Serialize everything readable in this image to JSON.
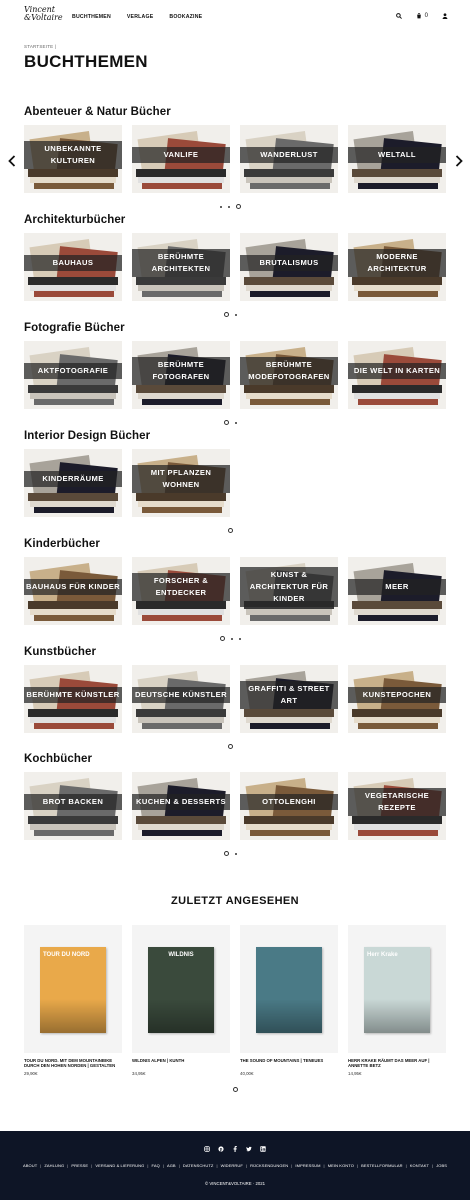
{
  "header": {
    "logo_line1": "Vincent",
    "logo_line2": "&Voltaire",
    "nav": [
      "BUCHTHEMEN",
      "VERLAGE",
      "BOOKAZINE"
    ],
    "cart_count": "0"
  },
  "breadcrumb": "STARTSEITE |",
  "page_title": "BUCHTHEMEN",
  "sections": [
    {
      "title": "Abenteuer & Natur Bücher",
      "tiles": [
        {
          "label": "UNBEKANNTE KULTUREN",
          "lines": 2
        },
        {
          "label": "VANLIFE",
          "lines": 1
        },
        {
          "label": "WANDERLUST",
          "lines": 1
        },
        {
          "label": "WELTALL",
          "lines": 1
        }
      ],
      "dots": 3,
      "active": 2
    },
    {
      "title": "Architekturbücher",
      "tiles": [
        {
          "label": "BAUHAUS",
          "lines": 1
        },
        {
          "label": "BERÜHMTE ARCHITEKTEN",
          "lines": 2
        },
        {
          "label": "BRUTALISMUS",
          "lines": 1
        },
        {
          "label": "MODERNE ARCHITEKTUR",
          "lines": 2
        }
      ],
      "dots": 2,
      "active": 0
    },
    {
      "title": "Fotografie Bücher",
      "tiles": [
        {
          "label": "AKTFOTOGRAFIE",
          "lines": 1
        },
        {
          "label": "BERÜHMTE FOTOGRAFEN",
          "lines": 2
        },
        {
          "label": "BERÜHMTE MODEFOTOGRAFEN",
          "lines": 2
        },
        {
          "label": "DIE WELT IN KARTEN",
          "lines": 1
        }
      ],
      "dots": 2,
      "active": 0
    },
    {
      "title": "Interior Design Bücher",
      "tiles": [
        {
          "label": "KINDERRÄUME",
          "lines": 1
        },
        {
          "label": "MIT PFLANZEN WOHNEN",
          "lines": 2
        }
      ],
      "dots": 1,
      "active": 0
    },
    {
      "title": "Kinderbücher",
      "tiles": [
        {
          "label": "BAUHAUS FÜR KINDER",
          "lines": 1
        },
        {
          "label": "FORSCHER & ENTDECKER",
          "lines": 2
        },
        {
          "label": "KUNST & ARCHITEKTUR FÜR KINDER",
          "lines": 3
        },
        {
          "label": "MEER",
          "lines": 1
        }
      ],
      "dots": 3,
      "active": 0
    },
    {
      "title": "Kunstbücher",
      "tiles": [
        {
          "label": "BERÜHMTE KÜNSTLER",
          "lines": 1
        },
        {
          "label": "DEUTSCHE KÜNSTLER",
          "lines": 1
        },
        {
          "label": "GRAFFITI & STREET ART",
          "lines": 2
        },
        {
          "label": "KUNSTEPOCHEN",
          "lines": 1
        }
      ],
      "dots": 1,
      "active": 0
    },
    {
      "title": "Kochbücher",
      "tiles": [
        {
          "label": "BROT BACKEN",
          "lines": 1
        },
        {
          "label": "KUCHEN & DESSERTS",
          "lines": 1
        },
        {
          "label": "OTTOLENGHI",
          "lines": 1
        },
        {
          "label": "VEGETARISCHE REZEPTE",
          "lines": 2
        }
      ],
      "dots": 2,
      "active": 0
    }
  ],
  "recently_viewed": {
    "title": "ZULETZT ANGESEHEN",
    "products": [
      {
        "name": "TOUR DU NORD. MIT DEM MOUNTAINBIKE DURCH DEN HOHEN NORDEN | GESTALTEN",
        "price": "29,90€",
        "cover_color": "#e9a94a",
        "cover_title": "TOUR DU NORD"
      },
      {
        "name": "WILDNIS ALPEN | KUNTH",
        "price": "34,95€",
        "cover_color": "#3a4a3c",
        "cover_title": "WILDNIS"
      },
      {
        "name": "THE SOUND OF MOUNTAINS | TENEUES",
        "price": "40,00€",
        "cover_color": "#4a7a86",
        "cover_title": ""
      },
      {
        "name": "HERR KRAKE RÄUMT DAS MEER AUF | ANNETTE BETZ",
        "price": "14,95€",
        "cover_color": "#c9d8d6",
        "cover_title": "Herr Krake"
      }
    ]
  },
  "footer": {
    "social_icons": [
      "instagram-icon",
      "pinterest-icon",
      "facebook-icon",
      "twitter-icon",
      "linkedin-icon"
    ],
    "links": [
      "ABOUT",
      "ZAHLUNG",
      "PRESSE",
      "VERSAND & LIEFERUNG",
      "FAQ",
      "AGB",
      "DATENSCHUTZ",
      "WIDERRUF",
      "RÜCKSENDUNGEN",
      "IMPRESSUM",
      "MEIN KONTO",
      "BESTELLFORMULAR",
      "KONTAKT",
      "JOBS"
    ],
    "copyright": "© VINCENT&VOLTAIRE · 2021"
  }
}
